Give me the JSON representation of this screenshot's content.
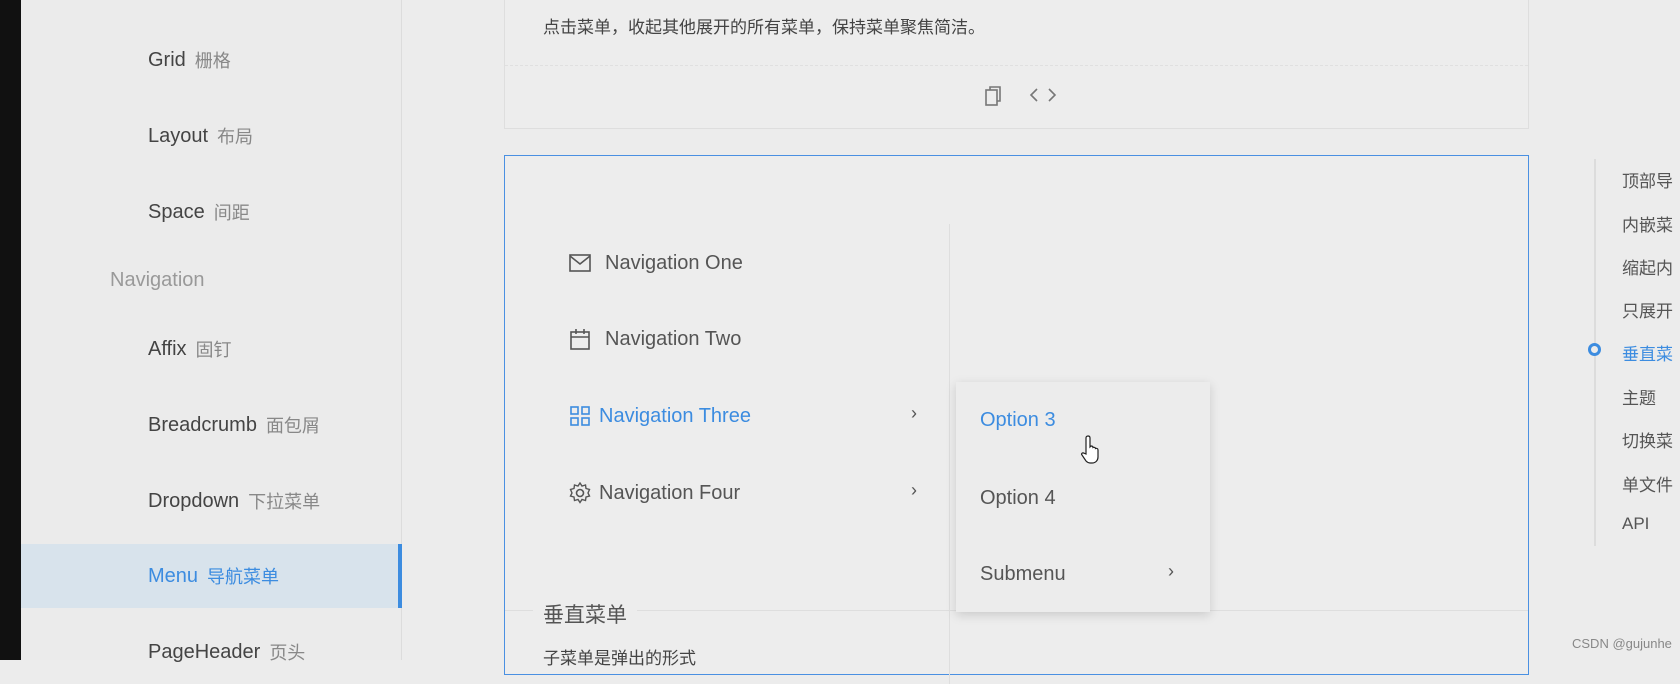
{
  "sidebar": {
    "items": [
      {
        "label": "Grid",
        "cn": "栅格"
      },
      {
        "label": "Layout",
        "cn": "布局"
      },
      {
        "label": "Space",
        "cn": "间距"
      },
      {
        "label": "Affix",
        "cn": "固钉"
      },
      {
        "label": "Breadcrumb",
        "cn": "面包屑"
      },
      {
        "label": "Dropdown",
        "cn": "下拉菜单"
      },
      {
        "label": "Menu",
        "cn": "导航菜单",
        "selected": true
      },
      {
        "label": "PageHeader",
        "cn": "页头"
      }
    ],
    "group_navigation": "Navigation"
  },
  "demo_prev": {
    "description": "点击菜单，收起其他展开的所有菜单，保持菜单聚焦简洁。",
    "icons": [
      "copy-icon",
      "code-icon"
    ]
  },
  "demo": {
    "menu": [
      {
        "label": "Navigation One",
        "icon": "mail-icon"
      },
      {
        "label": "Navigation Two",
        "icon": "calendar-icon"
      },
      {
        "label": "Navigation Three",
        "icon": "appstore-icon",
        "active": true
      },
      {
        "label": "Navigation Four",
        "icon": "setting-icon"
      }
    ],
    "popup": [
      {
        "label": "Option 3",
        "active": true
      },
      {
        "label": "Option 4"
      },
      {
        "label": "Submenu"
      }
    ],
    "title": "垂直菜单",
    "description": "子菜单是弹出的形式"
  },
  "anchors": [
    "顶部导",
    "内嵌菜",
    "缩起内",
    "只展开",
    "垂直菜",
    "主题",
    "切换菜",
    "单文件",
    "API"
  ],
  "anchor_active_index": 4,
  "watermark": "CSDN @gujunhe",
  "colors": {
    "accent": "#3c8ce0",
    "background": "#ececec"
  }
}
